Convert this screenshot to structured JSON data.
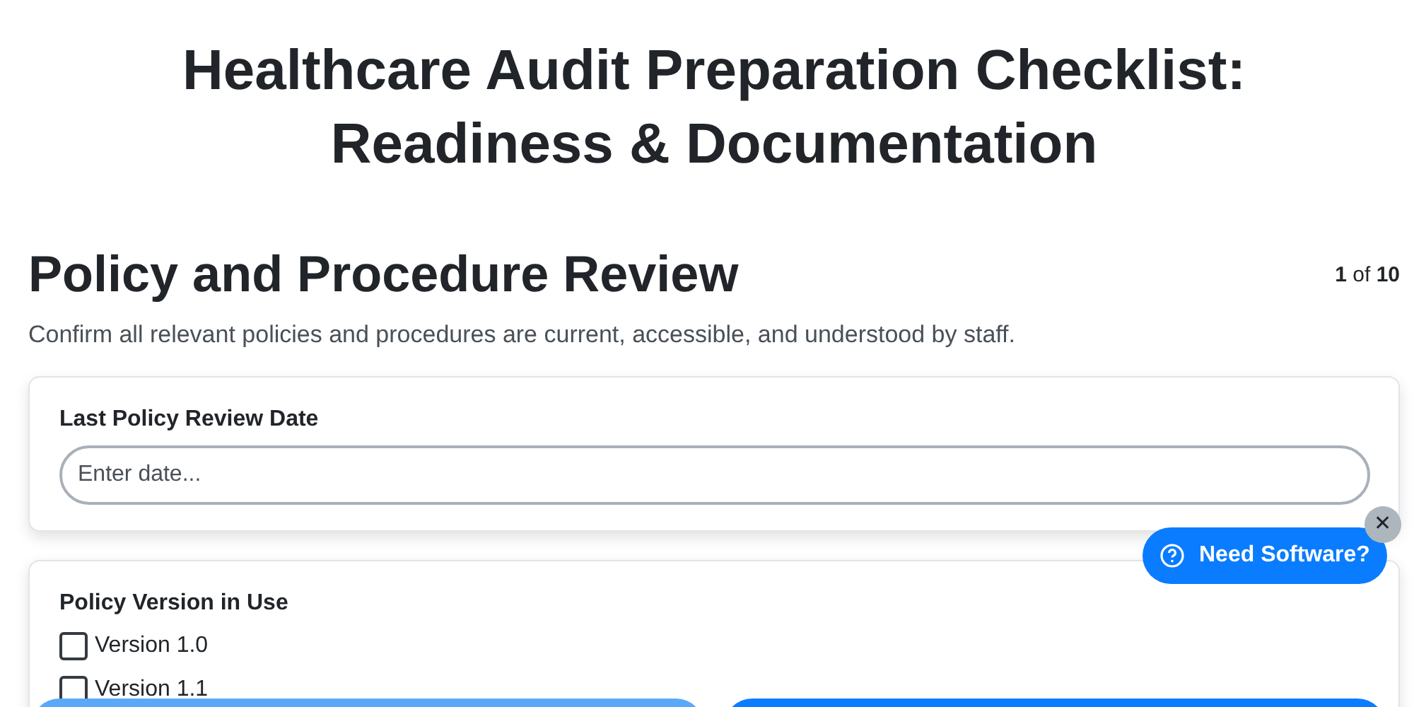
{
  "title": "Healthcare Audit Preparation Checklist: Readiness & Documentation",
  "section": {
    "heading": "Policy and Procedure Review",
    "page_current": "1",
    "page_of": "of",
    "page_total": "10",
    "description": "Confirm all relevant policies and procedures are current, accessible, and understood by staff."
  },
  "fields": [
    {
      "kind": "text",
      "label": "Last Policy Review Date",
      "placeholder": "Enter date..."
    },
    {
      "kind": "checklist",
      "label": "Policy Version in Use",
      "options": [
        {
          "label": "Version 1.0",
          "checked": false
        },
        {
          "label": "Version 1.1",
          "checked": false
        }
      ]
    }
  ],
  "help_button": {
    "label": "Need Software?"
  },
  "close_button": {
    "label": "✕"
  }
}
